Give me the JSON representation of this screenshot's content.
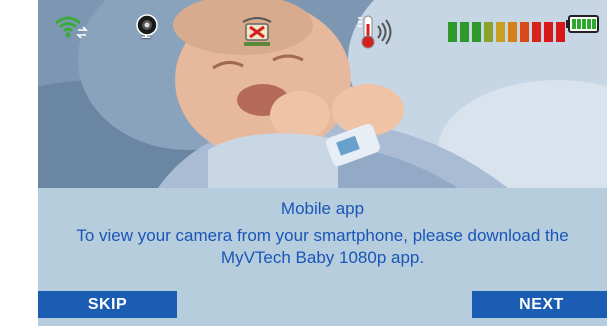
{
  "status_bar": {
    "wifi_icon": "wifi-signal-icon",
    "camera_icon": "camera-icon",
    "camera_number": "1",
    "night_light_icon": "night-light-icon",
    "temperature_icon": "thermometer-sound-icon",
    "signal_strength_levels": 10,
    "signal_strength_filled": 10,
    "signal_bar_colors": [
      "#2e9a2e",
      "#2e9a2e",
      "#2e9a2e",
      "#8aa32a",
      "#c8a020",
      "#d58018",
      "#d84a18",
      "#d82418",
      "#d81818",
      "#d81818"
    ],
    "battery_icon": "battery-full-icon",
    "battery_color": "#2eaa2e"
  },
  "dialog": {
    "title": "Mobile app",
    "message": "To view your camera from your smartphone, please download the MyVTech Baby 1080p app.",
    "skip_label": "SKIP",
    "next_label": "NEXT"
  },
  "colors": {
    "panel_background": "#b6cddd",
    "text": "#1a55b8",
    "button": "#1a5db3"
  }
}
